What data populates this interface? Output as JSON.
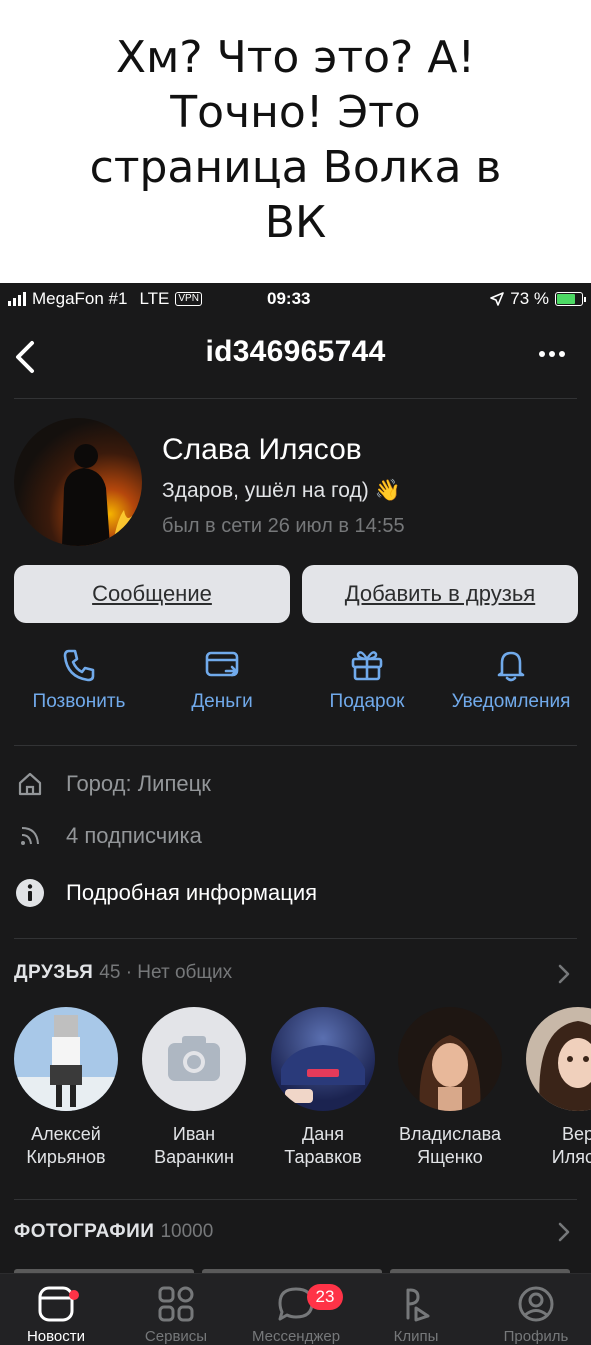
{
  "caption": {
    "line1": "Хм? Что это? А!",
    "line2": "Точно! Это",
    "line3": "страница Волка в",
    "line4": "ВК"
  },
  "status_bar": {
    "carrier": "MegaFon #1",
    "network": "LTE",
    "vpn": "VPN",
    "time": "09:33",
    "battery": "73 %",
    "battery_level": 0.73
  },
  "nav": {
    "title": "id346965744"
  },
  "profile": {
    "name": "Слава Илясов",
    "status": "Здаров, ушёл на год) 👋",
    "last_seen": "был в сети 26 июл в 14:55"
  },
  "buttons": {
    "message": "Сообщение",
    "add_friend": "Добавить в друзья"
  },
  "actions": [
    {
      "label": "Позвонить",
      "icon": "phone-icon"
    },
    {
      "label": "Деньги",
      "icon": "money-icon"
    },
    {
      "label": "Подарок",
      "icon": "gift-icon"
    },
    {
      "label": "Уведомления",
      "icon": "bell-icon"
    }
  ],
  "info": {
    "city": "Город: Липецк",
    "followers": "4 подписчика",
    "details": "Подробная информация"
  },
  "friends_section": {
    "title": "ДРУЗЬЯ",
    "count": "45 · Нет общих",
    "items": [
      {
        "first": "Алексей",
        "last": "Кирьянов"
      },
      {
        "first": "Иван",
        "last": "Варанкин"
      },
      {
        "first": "Даня",
        "last": "Таравков"
      },
      {
        "first": "Владислава",
        "last": "Ященко"
      },
      {
        "first": "Вер",
        "last": "Илясо"
      }
    ]
  },
  "photos_section": {
    "title": "ФОТОГРАФИИ",
    "count": "10000"
  },
  "tabbar": {
    "tabs": [
      {
        "label": "Новости",
        "icon": "news-icon"
      },
      {
        "label": "Сервисы",
        "icon": "services-icon"
      },
      {
        "label": "Мессенджер",
        "icon": "messenger-icon",
        "badge": "23"
      },
      {
        "label": "Клипы",
        "icon": "clips-icon"
      },
      {
        "label": "Профиль",
        "icon": "profile-icon"
      }
    ]
  },
  "colors": {
    "background": "#19191a",
    "accent": "#71aaeb",
    "badge": "#ff3347"
  }
}
